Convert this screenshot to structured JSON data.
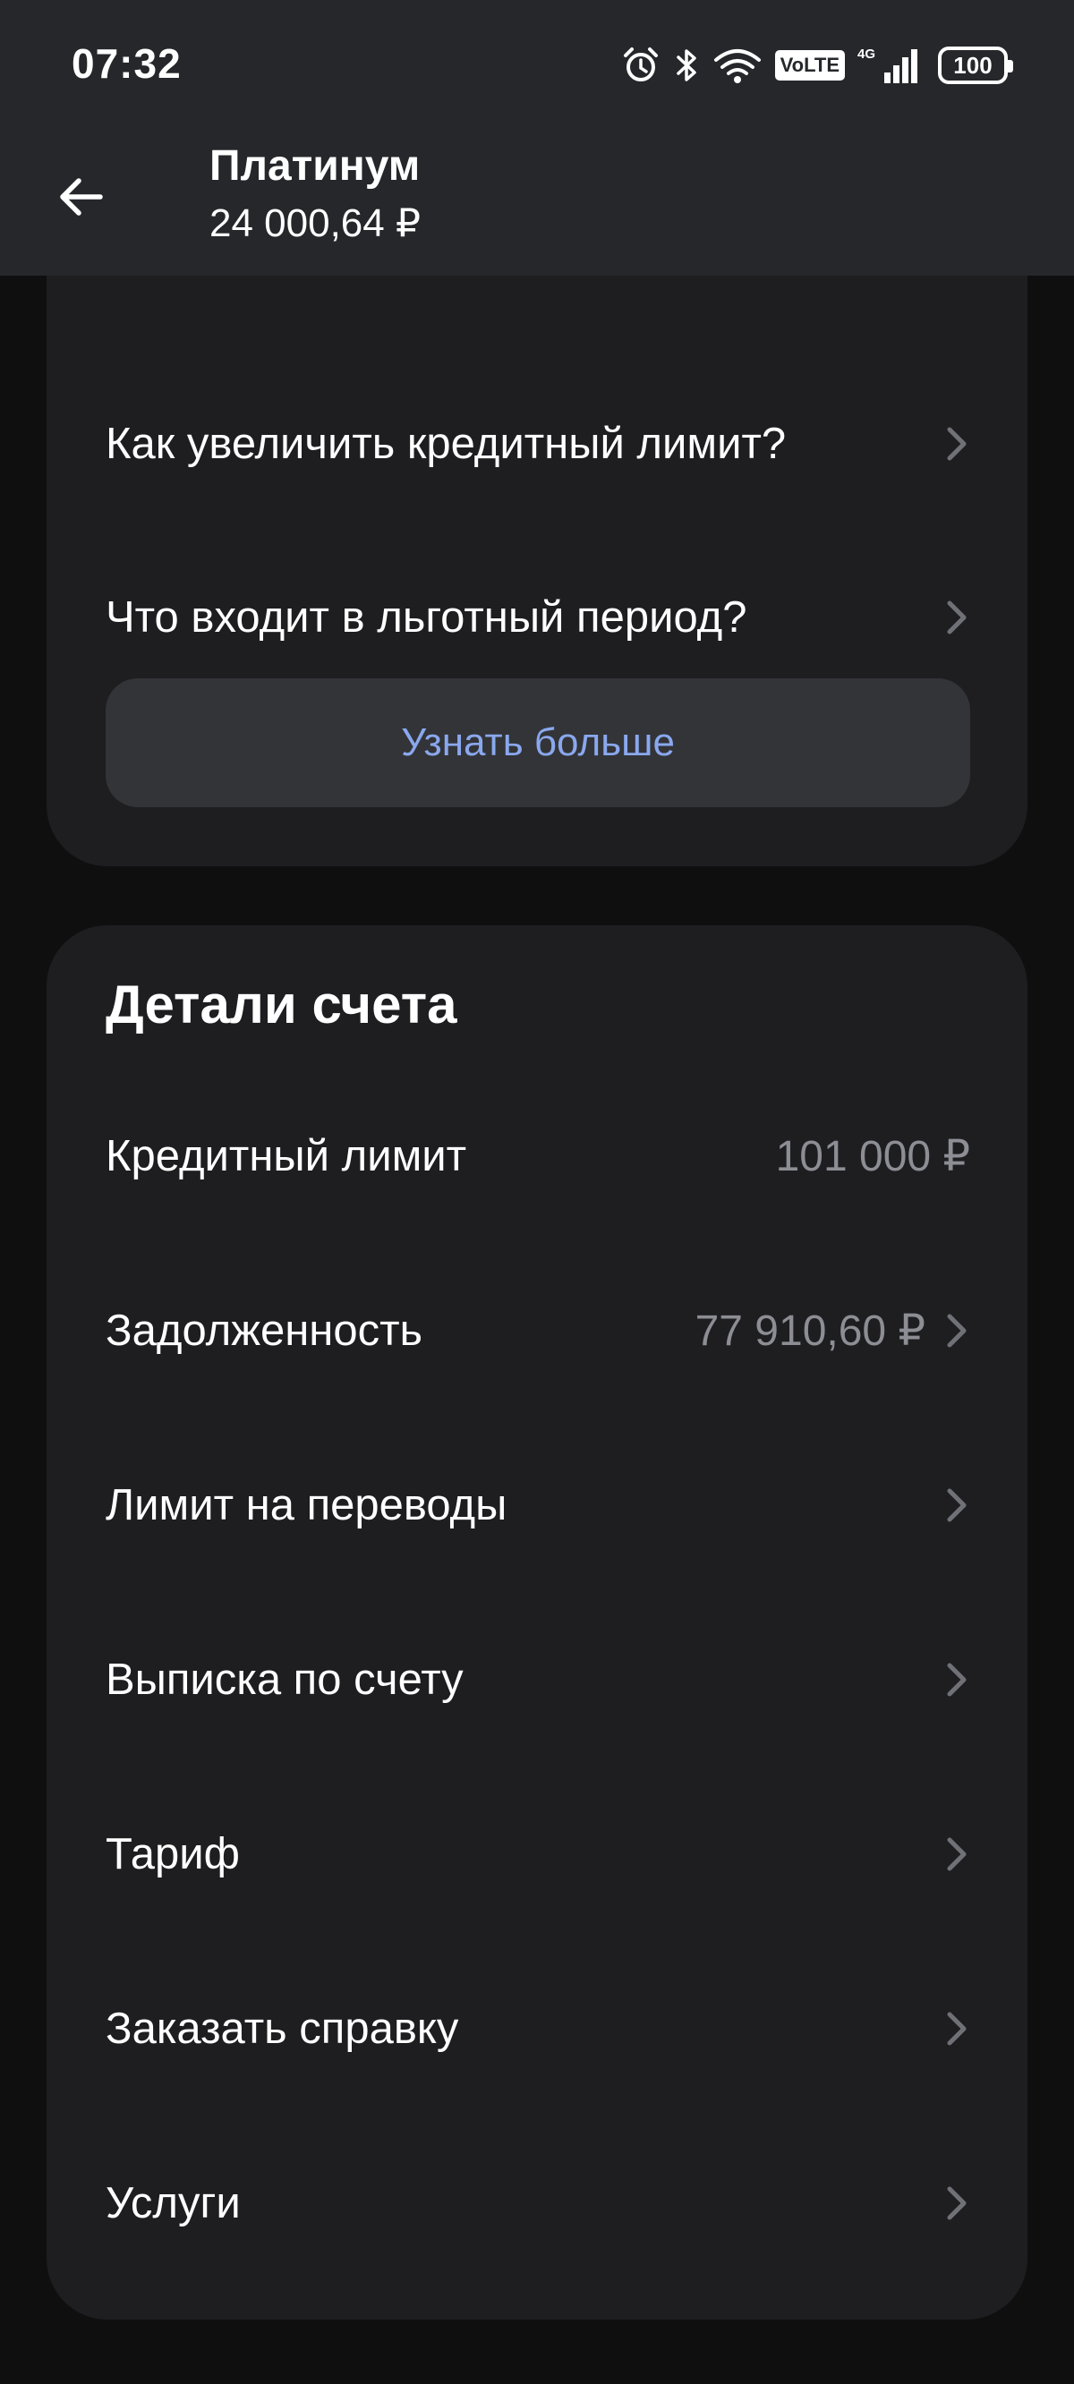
{
  "status_bar": {
    "time": "07:32",
    "volte_label": "VoLTE",
    "network_label": "4G",
    "battery_level": "100"
  },
  "header": {
    "title": "Платинум",
    "subtitle": "24 000,64 ₽"
  },
  "faq": {
    "items": [
      {
        "label": "Как увеличить кредитный лимит?"
      },
      {
        "label": "Что входит в льготный период?"
      }
    ],
    "more_button": "Узнать больше"
  },
  "account_details": {
    "title": "Детали счета",
    "rows": [
      {
        "label": "Кредитный лимит",
        "value": "101 000 ₽"
      },
      {
        "label": "Задолженность",
        "value": "77 910,60 ₽"
      },
      {
        "label": "Лимит на переводы"
      },
      {
        "label": "Выписка по счету"
      },
      {
        "label": "Тариф"
      },
      {
        "label": "Заказать справку"
      },
      {
        "label": "Услуги"
      }
    ]
  },
  "colors": {
    "header_bg": "#25272b",
    "card_bg": "#1e1e21",
    "page_bg": "#0f0f10",
    "accent_link": "#8aa8ee",
    "secondary_text": "#8c8e94"
  }
}
